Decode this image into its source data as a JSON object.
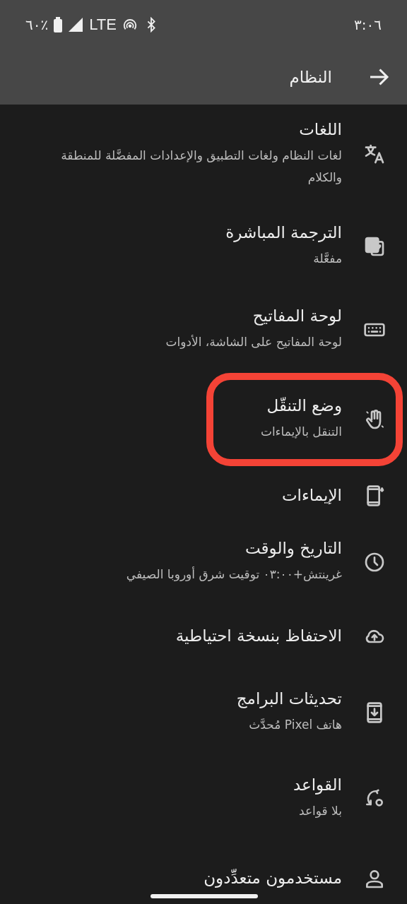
{
  "status_bar": {
    "time": "٣:٠٦",
    "battery": "٦٠٪",
    "network": "LTE"
  },
  "header": {
    "title": "النظام"
  },
  "items": [
    {
      "title": "اللغات",
      "subtitle": "لغات النظام ولغات التطبيق والإعدادات المفضَّلة للمنطقة والكلام",
      "highlighted": false
    },
    {
      "title": "الترجمة المباشرة",
      "subtitle": "مفعَّلة",
      "highlighted": false
    },
    {
      "title": "لوحة المفاتيح",
      "subtitle": "لوحة المفاتيح على الشاشة، الأدوات",
      "highlighted": false
    },
    {
      "title": "وضع التنقّل",
      "subtitle": "التنقل بالإيماءات",
      "highlighted": true
    },
    {
      "title": "الإيماءات",
      "highlighted": false
    },
    {
      "title": "التاريخ والوقت",
      "subtitle": "غرينتش+٠٣:٠٠ توقيت شرق أوروبا الصيفي",
      "highlighted": false
    },
    {
      "title": "الاحتفاظ بنسخة احتياطية",
      "highlighted": false
    },
    {
      "title": "تحديثات البرامج",
      "subtitle": "هاتف Pixel مُحدَّث",
      "highlighted": false
    },
    {
      "title": "القواعد",
      "subtitle": "بلا قواعد",
      "highlighted": false
    },
    {
      "title": "مستخدمون متعدِّدون",
      "highlighted": false
    }
  ]
}
